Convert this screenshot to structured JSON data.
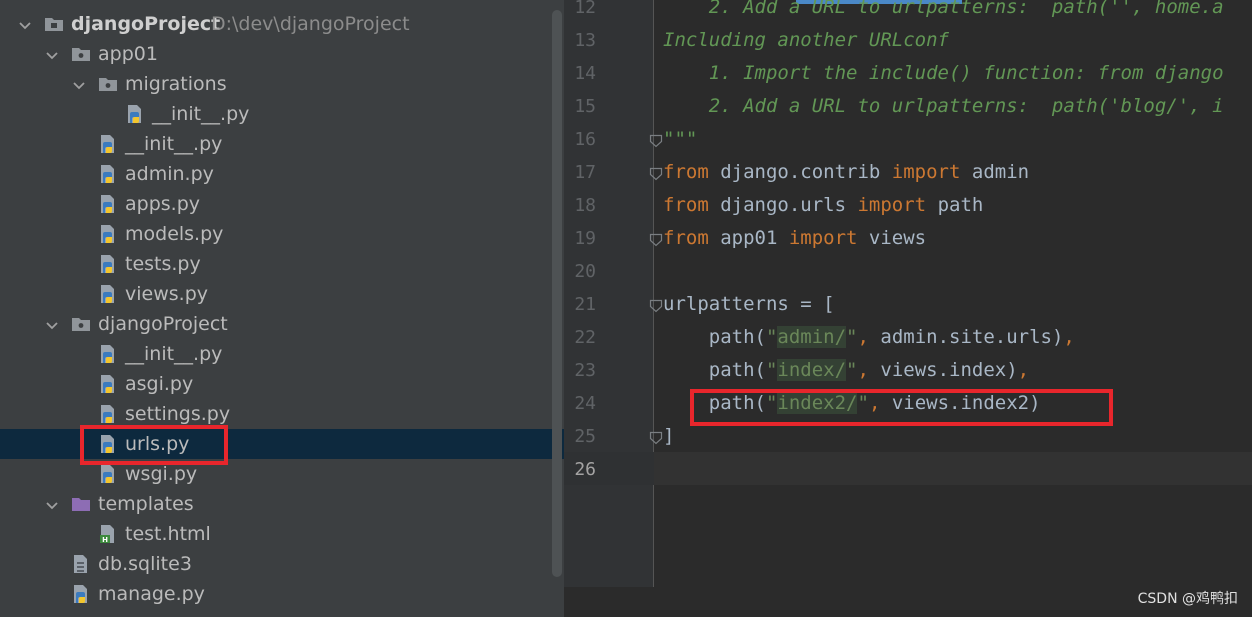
{
  "project_tree": {
    "items": [
      {
        "label": "djangoProject",
        "path": "D:\\dev\\djangoProject",
        "type": "project-folder",
        "expanded": true,
        "depth": 0
      },
      {
        "label": "app01",
        "type": "package-folder",
        "expanded": true,
        "depth": 1
      },
      {
        "label": "migrations",
        "type": "package-folder",
        "expanded": true,
        "depth": 2
      },
      {
        "label": "__init__.py",
        "type": "python-file",
        "depth": 3
      },
      {
        "label": "__init__.py",
        "type": "python-file",
        "depth": 2
      },
      {
        "label": "admin.py",
        "type": "python-file",
        "depth": 2
      },
      {
        "label": "apps.py",
        "type": "python-file",
        "depth": 2
      },
      {
        "label": "models.py",
        "type": "python-file",
        "depth": 2
      },
      {
        "label": "tests.py",
        "type": "python-file",
        "depth": 2
      },
      {
        "label": "views.py",
        "type": "python-file",
        "depth": 2
      },
      {
        "label": "djangoProject",
        "type": "package-folder",
        "expanded": true,
        "depth": 1
      },
      {
        "label": "__init__.py",
        "type": "python-file",
        "depth": 2
      },
      {
        "label": "asgi.py",
        "type": "python-file",
        "depth": 2
      },
      {
        "label": "settings.py",
        "type": "python-file",
        "depth": 2
      },
      {
        "label": "urls.py",
        "type": "python-file",
        "depth": 2,
        "selected": true
      },
      {
        "label": "wsgi.py",
        "type": "python-file",
        "depth": 2
      },
      {
        "label": "templates",
        "type": "templates-folder",
        "expanded": true,
        "depth": 1
      },
      {
        "label": "test.html",
        "type": "html-file",
        "depth": 2
      },
      {
        "label": "db.sqlite3",
        "type": "database-file",
        "depth": 1
      },
      {
        "label": "manage.py",
        "type": "python-file",
        "depth": 1
      }
    ]
  },
  "editor": {
    "lines": [
      {
        "num": "12",
        "segments": [
          {
            "t": "    2. Add a URL to urlpatterns:  path('', home.a",
            "c": "doc"
          }
        ]
      },
      {
        "num": "13",
        "segments": [
          {
            "t": "Including another URLconf",
            "c": "doc"
          }
        ]
      },
      {
        "num": "14",
        "segments": [
          {
            "t": "    1. Import the include() function: from django",
            "c": "doc"
          }
        ]
      },
      {
        "num": "15",
        "segments": [
          {
            "t": "    2. Add a URL to urlpatterns:  path('blog/', i",
            "c": "doc"
          }
        ]
      },
      {
        "num": "16",
        "segments": [
          {
            "t": "\"\"\"",
            "c": "doc"
          }
        ],
        "fold": true
      },
      {
        "num": "17",
        "segments": [
          {
            "t": "from",
            "c": "kw"
          },
          {
            "t": " django.contrib ",
            "c": ""
          },
          {
            "t": "import",
            "c": "kw"
          },
          {
            "t": " admin",
            "c": ""
          }
        ],
        "fold": true
      },
      {
        "num": "18",
        "segments": [
          {
            "t": "from",
            "c": "kw"
          },
          {
            "t": " django.urls ",
            "c": ""
          },
          {
            "t": "import",
            "c": "kw"
          },
          {
            "t": " path",
            "c": ""
          }
        ]
      },
      {
        "num": "19",
        "segments": [
          {
            "t": "from",
            "c": "kw"
          },
          {
            "t": " app01 ",
            "c": ""
          },
          {
            "t": "import",
            "c": "kw"
          },
          {
            "t": " views",
            "c": ""
          }
        ],
        "fold": true
      },
      {
        "num": "20",
        "segments": []
      },
      {
        "num": "21",
        "segments": [
          {
            "t": "urlpatterns = [",
            "c": ""
          }
        ],
        "fold": true
      },
      {
        "num": "22",
        "segments": [
          {
            "t": "    path(",
            "c": ""
          },
          {
            "t": "\"",
            "c": "str"
          },
          {
            "t": "admin/",
            "c": "strhl"
          },
          {
            "t": "\"",
            "c": "str"
          },
          {
            "t": ", ",
            "c": "kw"
          },
          {
            "t": "admin.site.urls)",
            "c": ""
          },
          {
            "t": ",",
            "c": "kw"
          }
        ]
      },
      {
        "num": "23",
        "segments": [
          {
            "t": "    path(",
            "c": ""
          },
          {
            "t": "\"",
            "c": "str"
          },
          {
            "t": "index/",
            "c": "strhl"
          },
          {
            "t": "\"",
            "c": "str"
          },
          {
            "t": ", ",
            "c": "kw"
          },
          {
            "t": "views.index)",
            "c": ""
          },
          {
            "t": ",",
            "c": "kw"
          }
        ]
      },
      {
        "num": "24",
        "segments": [
          {
            "t": "    path(",
            "c": ""
          },
          {
            "t": "\"",
            "c": "str"
          },
          {
            "t": "index2/",
            "c": "strhl"
          },
          {
            "t": "\"",
            "c": "str"
          },
          {
            "t": ", ",
            "c": "kw"
          },
          {
            "t": "views.index2)",
            "c": ""
          }
        ]
      },
      {
        "num": "25",
        "segments": [
          {
            "t": "]",
            "c": ""
          }
        ],
        "fold": true
      },
      {
        "num": "26",
        "segments": [],
        "current": true
      }
    ]
  },
  "watermark": "CSDN @鸡鸭扣",
  "colors": {
    "tree_bg": "#3c3f41",
    "editor_bg": "#2b2b2b",
    "selection": "#0d293e",
    "annotation_red": "#e8262c",
    "keyword": "#cc7832",
    "string": "#6a8759",
    "docstring": "#629755"
  }
}
